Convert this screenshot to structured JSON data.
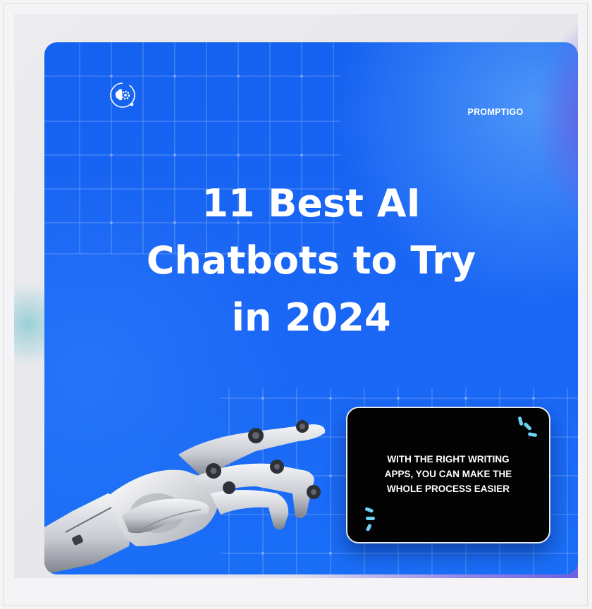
{
  "brand": {
    "name": "PROMPTIGO",
    "logo_icon": "brain-gear-icon"
  },
  "headline": {
    "lines": [
      "11 Best AI",
      "Chatbots to Try",
      "in 2024"
    ]
  },
  "callout": {
    "lines": [
      "WITH THE RIGHT WRITING",
      "APPS, YOU CAN MAKE THE",
      "WHOLE PROCESS EASIER"
    ],
    "decoration_icon": "sparkle-burst-icon"
  },
  "illustration": {
    "icon": "robot-hand-icon"
  },
  "colors": {
    "poster_blue": "#1a66f5",
    "callout_bg": "#030304",
    "accent_cyan": "#6fd3f5",
    "text": "#ffffff"
  }
}
